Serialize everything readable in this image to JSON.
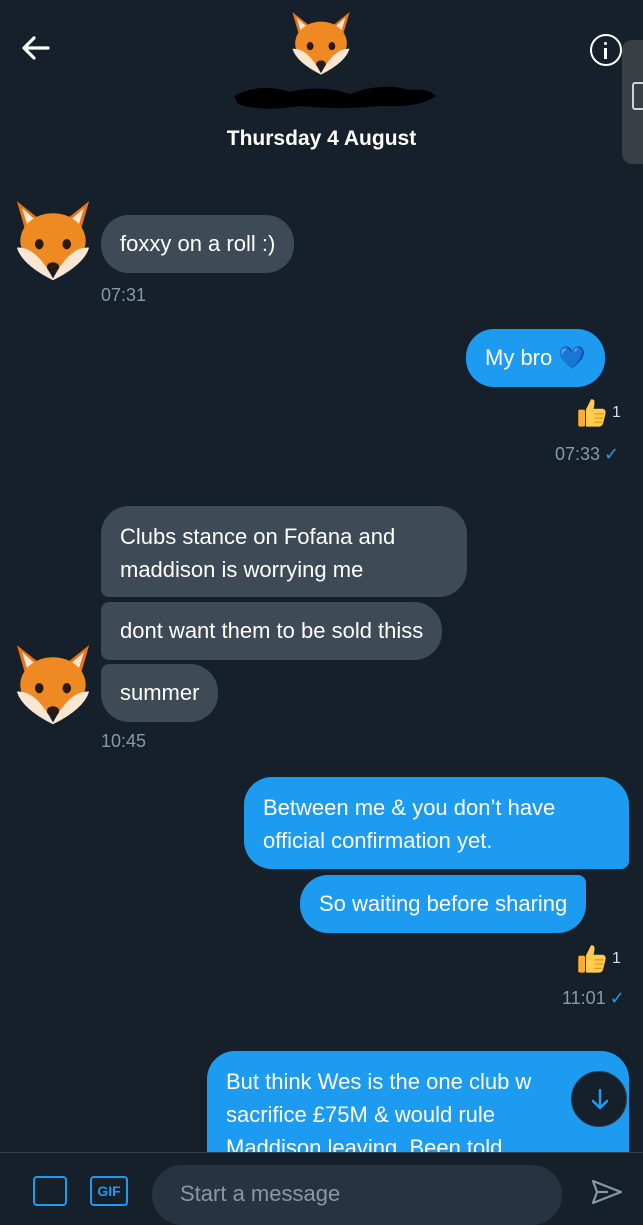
{
  "header": {
    "date_label": "Thursday 4 August"
  },
  "messages": [
    {
      "side": "in",
      "text": "foxxy on a roll :)",
      "time": "07:31"
    },
    {
      "side": "out",
      "text": "My bro 💙",
      "reaction_count": "1",
      "time": "07:33"
    },
    {
      "side": "in",
      "lines": [
        "Clubs stance on Fofana and",
        "maddison is worrying me"
      ]
    },
    {
      "side": "in",
      "text": "dont want them to be sold thiss"
    },
    {
      "side": "in",
      "text": "summer",
      "time": "10:45"
    },
    {
      "side": "out",
      "lines": [
        "Between me & you don’t have",
        "official confirmation yet."
      ]
    },
    {
      "side": "out",
      "text": "So waiting before sharing",
      "reaction_count": "1",
      "time": "11:01"
    },
    {
      "side": "out",
      "lines": [
        "But think Wes is the one club w",
        "sacrifice £75M & would rule",
        "Maddison leaving. Been told"
      ]
    }
  ],
  "composer": {
    "placeholder": "Start a message",
    "gif_label": "GIF"
  },
  "icons": {
    "back": "arrow-left-icon",
    "info": "info-icon",
    "media": "image-icon",
    "gif": "gif-icon",
    "send": "send-icon",
    "scroll_down": "arrow-down-icon",
    "reaction": "thumbs-up-icon",
    "avatar": "fox-face-icon"
  },
  "colors": {
    "background": "#15202b",
    "incoming_bubble": "#3e4a56",
    "outgoing_bubble": "#1d9bf0",
    "timestamp": "#8899a6",
    "accent": "#1d9bf0"
  }
}
